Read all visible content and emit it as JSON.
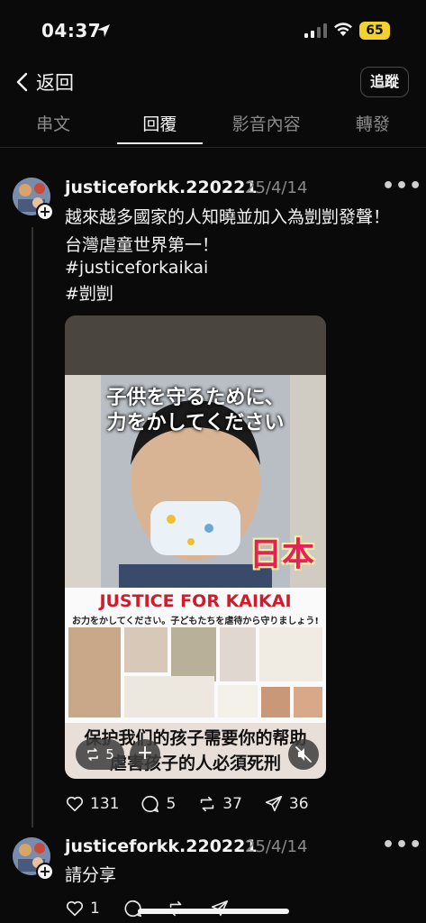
{
  "status_bar": {
    "time": "04:37",
    "battery": "65"
  },
  "header": {
    "back_label": "返回",
    "follow_label": "追蹤"
  },
  "tabs": [
    {
      "label": "串文"
    },
    {
      "label": "回覆"
    },
    {
      "label": "影音內容"
    },
    {
      "label": "轉發"
    }
  ],
  "posts": [
    {
      "username": "justiceforkk.220221",
      "date": "25/4/14",
      "lines": [
        "越來越多國家的人知曉並加入為剴剴發聲！",
        "台灣虐童世界第一！",
        "#justiceforkaikai",
        "#剴剴"
      ],
      "media": {
        "caption_line1": "子供を守るために、",
        "caption_line2": "力をかしてください",
        "country_tag": "日本",
        "poster_title": "JUSTICE FOR KAIKAI",
        "poster_subtitle": "お力をかしてください。子どもたちを虐待から守りましょう!",
        "bottom_line1": "保护我们的孩子需要你的帮助",
        "bottom_line2": "虐害孩子的人必須死刑",
        "repost_count": "5"
      },
      "stats": {
        "likes": "131",
        "comments": "5",
        "reposts": "37",
        "shares": "36"
      }
    },
    {
      "username": "justiceforkk.220221",
      "date": "25/4/14",
      "lines": [
        "請分享"
      ],
      "stats": {
        "likes": "1"
      }
    }
  ]
}
